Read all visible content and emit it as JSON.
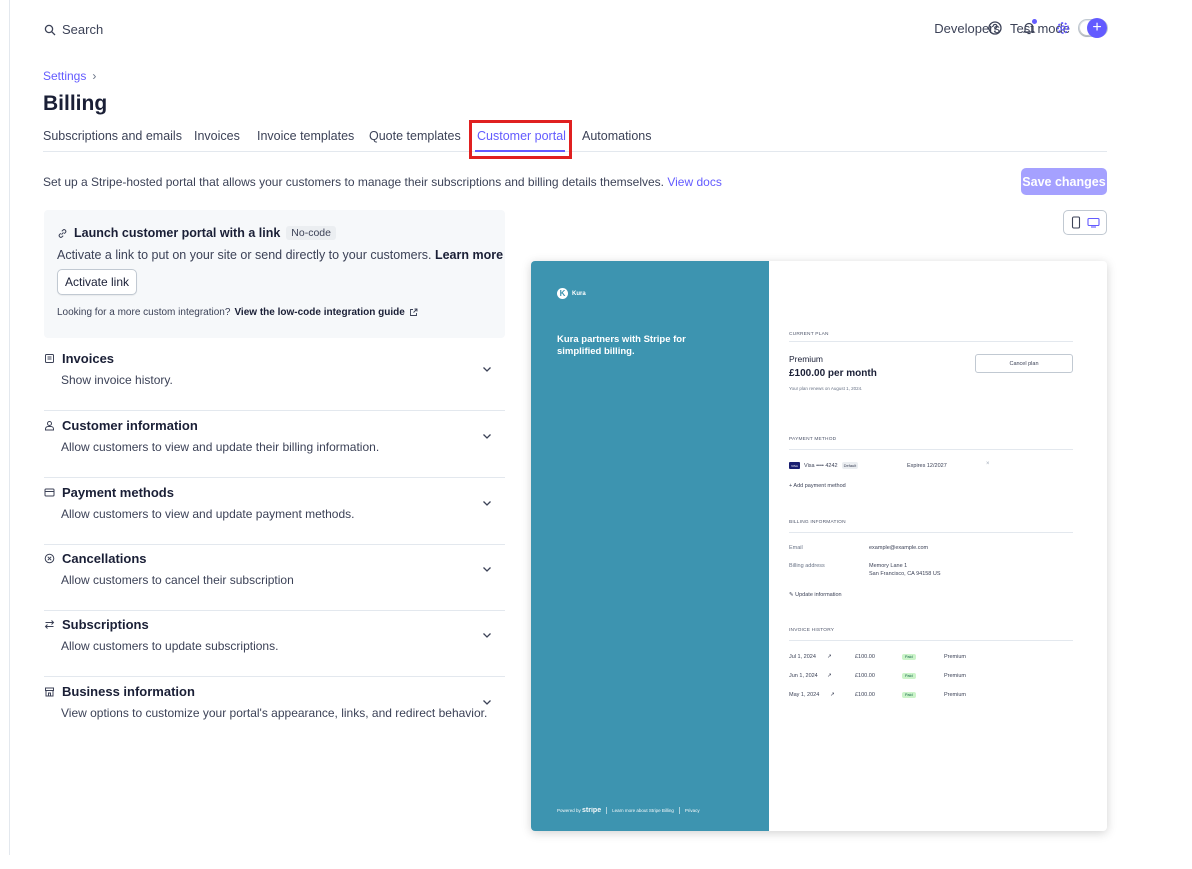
{
  "topbar": {
    "search_label": "Search",
    "developers_label": "Developers",
    "test_mode_label": "Test mode",
    "accent_color": "#635bff"
  },
  "breadcrumb": {
    "parent": "Settings",
    "separator": "›"
  },
  "page": {
    "title": "Billing"
  },
  "tabs": [
    {
      "label": "Subscriptions and emails"
    },
    {
      "label": "Invoices"
    },
    {
      "label": "Invoice templates"
    },
    {
      "label": "Quote templates"
    },
    {
      "label": "Customer portal"
    },
    {
      "label": "Automations"
    }
  ],
  "active_tab": "Customer portal",
  "intro": {
    "text": "Set up a Stripe-hosted portal that allows your customers to manage their subscriptions and billing details themselves.",
    "link": "View docs"
  },
  "save_button_label": "Save changes",
  "launch": {
    "title": "Launch customer portal with a link",
    "badge": "No-code",
    "description": "Activate a link to put on your site or send directly to your customers.",
    "learn_more": "Learn more",
    "activate_button": "Activate link",
    "footer_text": "Looking for a more custom integration?",
    "footer_link": "View the low-code integration guide"
  },
  "sections": [
    {
      "title": "Invoices",
      "description": "Show invoice history."
    },
    {
      "title": "Customer information",
      "description": "Allow customers to view and update their billing information."
    },
    {
      "title": "Payment methods",
      "description": "Allow customers to view and update payment methods."
    },
    {
      "title": "Cancellations",
      "description": "Allow customers to cancel their subscription"
    },
    {
      "title": "Subscriptions",
      "description": "Allow customers to update subscriptions."
    },
    {
      "title": "Business information",
      "description": "View options to customize your portal's appearance, links, and redirect behavior."
    }
  ],
  "preview": {
    "brand_color": "#3d94b0",
    "business_name": "Kura",
    "logo_letter": "K",
    "tagline": "Kura partners with Stripe for simplified billing.",
    "footer": {
      "powered_by": "Powered by",
      "stripe": "stripe",
      "learn_more": "Learn more about Stripe Billing",
      "privacy": "Privacy"
    },
    "current_plan_label": "CURRENT PLAN",
    "plan_name": "Premium",
    "plan_price": "£100.00 per month",
    "renewal_text": "Your plan renews on August 1, 2024.",
    "cancel_button": "Cancel plan",
    "payment_method_label": "PAYMENT METHOD",
    "card_brand_mark": "VISA",
    "card": "Visa •••• 4242",
    "card_default": "Default",
    "card_expires": "Expires 12/2027",
    "add_payment_method": "+ Add payment method",
    "billing_info_label": "BILLING INFORMATION",
    "email_label": "Email",
    "email_value": "example@example.com",
    "address_label": "Billing address",
    "address_line1": "Memory Lane 1",
    "address_line2": "San Francisco, CA 94158 US",
    "update_info": "Update information",
    "invoice_history_label": "INVOICE HISTORY",
    "invoices": [
      {
        "date": "Jul 1, 2024",
        "amount": "£100.00",
        "status": "Paid",
        "plan": "Premium"
      },
      {
        "date": "Jun 1, 2024",
        "amount": "£100.00",
        "status": "Paid",
        "plan": "Premium"
      },
      {
        "date": "May 1, 2024",
        "amount": "£100.00",
        "status": "Paid",
        "plan": "Premium"
      }
    ]
  }
}
